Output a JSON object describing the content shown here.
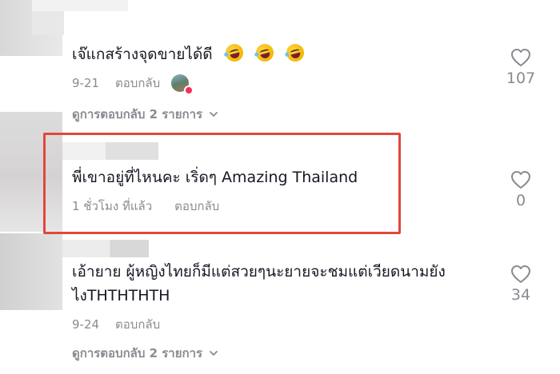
{
  "comments": [
    {
      "text": "เจ๊แกสร้างจุดขายได้ดี",
      "emoji_icons": [
        "rolling-laughing-emoji",
        "rolling-laughing-emoji",
        "rolling-laughing-emoji"
      ],
      "date": "9-21",
      "reply_label": "ตอบกลับ",
      "likes": "107",
      "view_replies_label": "ดูการตอบกลับ 2 รายการ"
    },
    {
      "text": "พี่เขาอยู่ที่ไหนคะ เริ่ดๆ Amazing Thailand",
      "date": "1 ชั่วโมง ที่แล้ว",
      "reply_label": "ตอบกลับ",
      "likes": "0",
      "highlight_color": "#e0483b"
    },
    {
      "text_line1": "เอ้ายาย ผู้หญิงไทยก็มีแต่สวยๆนะยายจะชมแต่เวียดนามยัง",
      "text_line2": "ไงTHTHTHTH",
      "date": "9-24",
      "reply_label": "ตอบกลับ",
      "likes": "34",
      "view_replies_label": "ดูการตอบกลับ 2 รายการ"
    }
  ],
  "colors": {
    "text": "#161823",
    "secondary": "#8a8b91",
    "badge": "#fe2c55"
  }
}
